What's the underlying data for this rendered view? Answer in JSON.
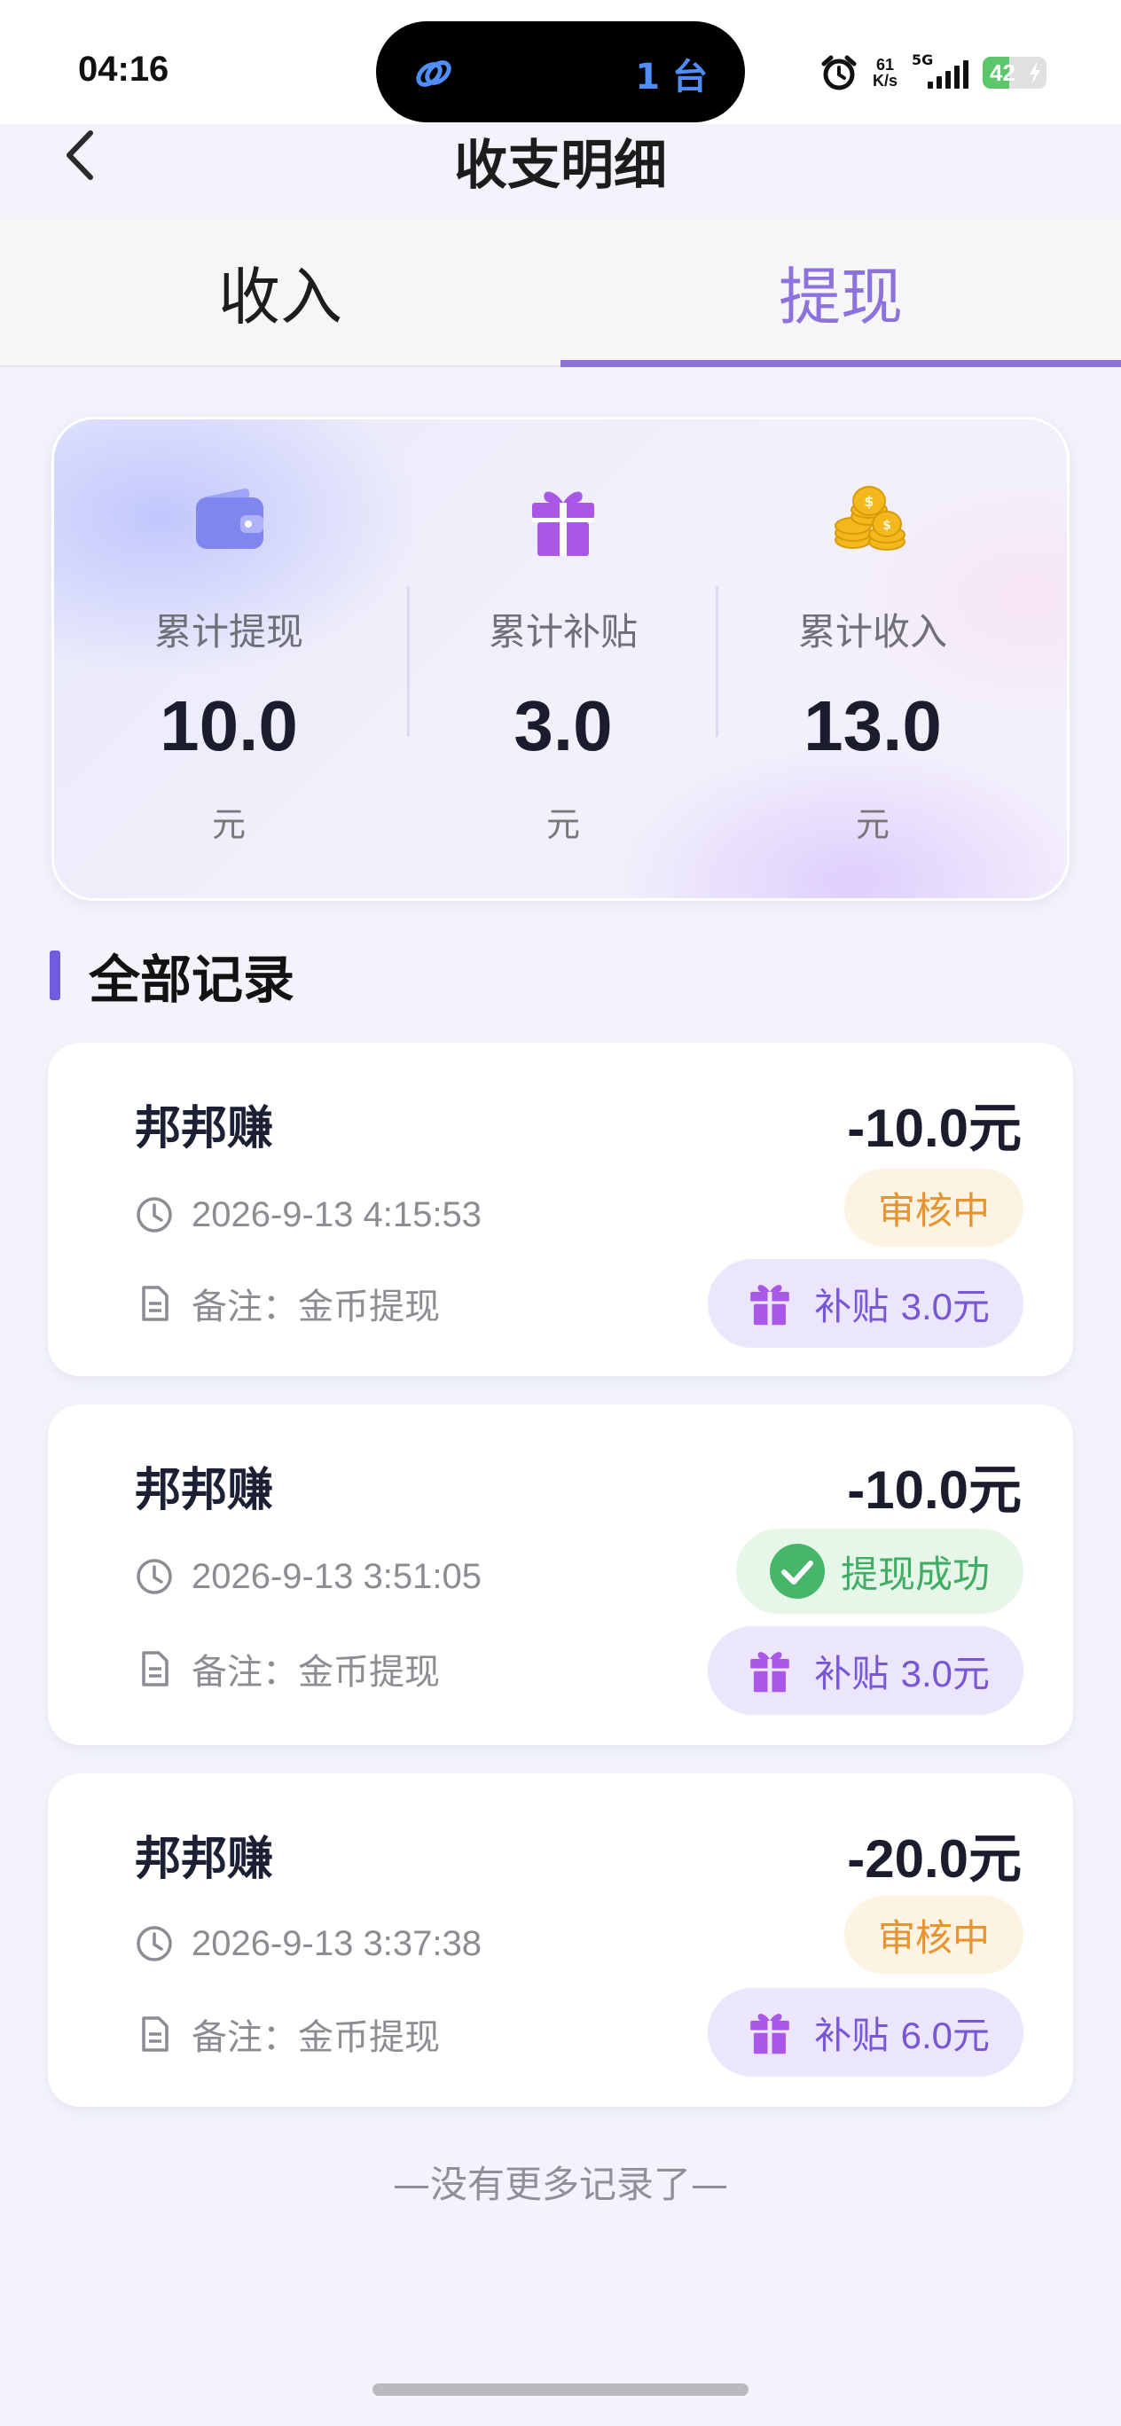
{
  "status_bar": {
    "time": "04:16",
    "island_text": "1 台",
    "net_speed_value": "61",
    "net_speed_unit": "K/s",
    "network_type": "5G",
    "battery_percent": "42",
    "battery_level": 0.42
  },
  "header": {
    "title": "收支明细",
    "back_icon": "chevron-left-icon"
  },
  "tabs": [
    {
      "label": "收入",
      "active": false
    },
    {
      "label": "提现",
      "active": true
    }
  ],
  "summary": {
    "items": [
      {
        "label": "累计提现",
        "value": "10.0",
        "unit": "元",
        "icon": "wallet-icon"
      },
      {
        "label": "累计补贴",
        "value": "3.0",
        "unit": "元",
        "icon": "gift-icon"
      },
      {
        "label": "累计收入",
        "value": "13.0",
        "unit": "元",
        "icon": "coins-icon"
      }
    ]
  },
  "section": {
    "title": "全部记录"
  },
  "records": [
    {
      "title": "邦邦赚",
      "amount": "-10.0元",
      "time": "2026-9-13 4:15:53",
      "note_prefix": "备注：",
      "note": "金币提现",
      "status": "审核中",
      "subsidy_label": "补贴 ",
      "subsidy_value": "3.0元"
    },
    {
      "title": "邦邦赚",
      "amount": "-10.0元",
      "time": "2026-9-13 3:51:05",
      "note_prefix": "备注：",
      "note": "金币提现",
      "status": "提现成功",
      "subsidy_label": "补贴 ",
      "subsidy_value": "3.0元"
    },
    {
      "title": "邦邦赚",
      "amount": "-20.0元",
      "time": "2026-9-13 3:37:38",
      "note_prefix": "备注：",
      "note": "金币提现",
      "status": "审核中",
      "subsidy_label": "补贴 ",
      "subsidy_value": "6.0元"
    }
  ],
  "footer": {
    "no_more": "—没有更多记录了—"
  },
  "colors": {
    "accent": "#8d72dd",
    "section_bar": "#6f5ce0",
    "pending": "#e59430",
    "success": "#3fae62",
    "subsidy": "#7856d4"
  }
}
